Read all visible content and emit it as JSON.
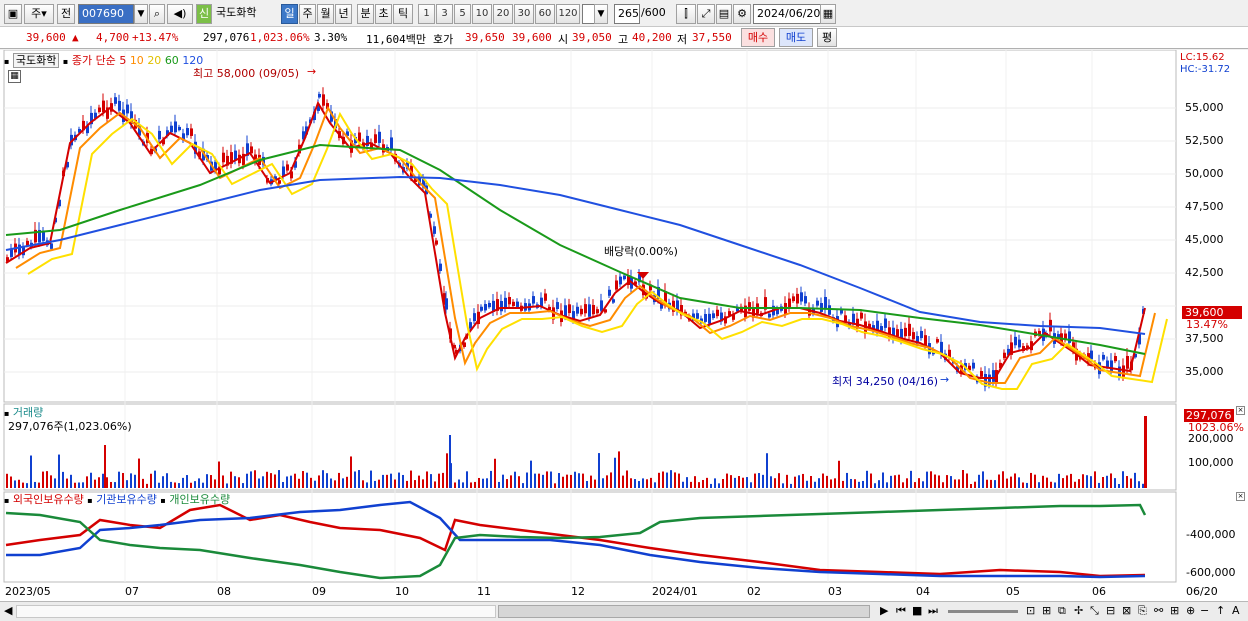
{
  "toolbar": {
    "period": "주",
    "prev_label": "전",
    "code": "007690",
    "stock_badge": "신",
    "stock_name": "국도화학",
    "tf_day": "일",
    "tf_week": "주",
    "tf_month": "월",
    "tf_year": "년",
    "tf_min": "분",
    "tf_tick": "초",
    "tf_tick2": "틱",
    "nums": [
      "1",
      "3",
      "5",
      "10",
      "20",
      "30",
      "60",
      "120"
    ],
    "count": "265",
    "count_max": "/600",
    "date": "2024/06/20"
  },
  "quote": {
    "price": "39,600",
    "arrow": "▲",
    "change": "4,700",
    "pct": "+13.47%",
    "volume": "297,076",
    "vol_ratio": "1,023.06%",
    "turnover": "3.30%",
    "amount": "11,604백만",
    "bid_label": "호가",
    "ask": "39,650",
    "bid": "39,600",
    "open_label": "시",
    "open": "39,050",
    "high_label": "고",
    "high": "40,200",
    "low_label": "저",
    "low": "37,550",
    "buy_label": "매수",
    "sell_label": "매도",
    "eval_label": "평"
  },
  "price_panel": {
    "name": "국도화학",
    "ma_label": "종가 단순",
    "ma_periods": [
      "5",
      "10",
      "20",
      "60",
      "120"
    ],
    "high_note": "최고 58,000 (09/05)",
    "low_note": "최저 34,250 (04/16)",
    "div_note": "배당락(0.00%)",
    "lc": "LC:15.62",
    "hc": "HC:-31.72",
    "last_price": "39,600",
    "last_pct": "13.47%",
    "y_ticks": [
      "55,000",
      "52,500",
      "50,000",
      "47,500",
      "45,000",
      "42,500",
      "40,000",
      "37,500",
      "35,000"
    ]
  },
  "volume_panel": {
    "title": "거래량",
    "value": "297,076주(1,023.06%)",
    "last": "297,076",
    "last_pct": "1023.06%",
    "y_ticks": [
      "200,000",
      "100,000"
    ]
  },
  "holding_panel": {
    "series": [
      "외국인보유수량",
      "기관보유수량",
      "개인보유수량"
    ],
    "y_ticks": [
      "-400,000",
      "-600,000"
    ]
  },
  "x_axis": [
    "2023/05",
    "07",
    "08",
    "09",
    "10",
    "11",
    "12",
    "2024/01",
    "02",
    "03",
    "04",
    "05",
    "06",
    "06/20"
  ],
  "colors": {
    "up": "#d40000",
    "down": "#1040d0",
    "ma5": "#d40000",
    "ma10": "#ff8c00",
    "ma20": "#ffe000",
    "ma60": "#1a9a1a",
    "ma120": "#2050e0"
  }
}
